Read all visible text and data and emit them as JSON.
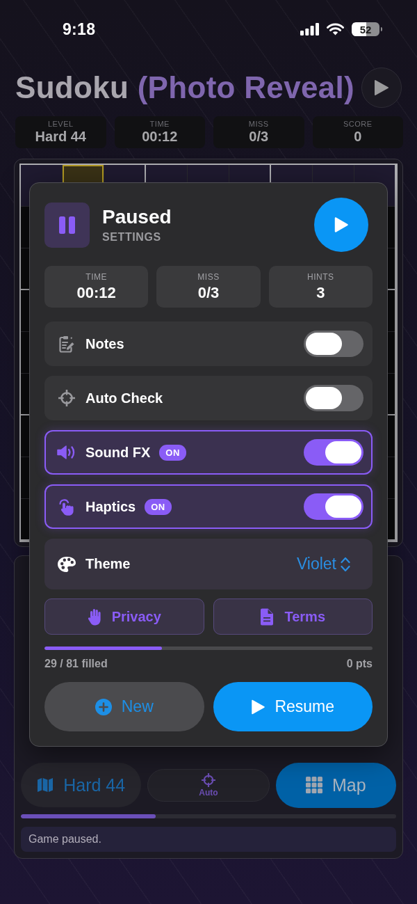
{
  "status_bar": {
    "time": "9:18",
    "battery": "52"
  },
  "header": {
    "title": "Sudoku",
    "title_accent": "(Photo Reveal)"
  },
  "stats": [
    {
      "label": "LEVEL",
      "value": "Hard 44"
    },
    {
      "label": "TIME",
      "value": "00:12"
    },
    {
      "label": "MISS",
      "value": "0/3"
    },
    {
      "label": "SCORE",
      "value": "0"
    }
  ],
  "board": {
    "top_row": [
      {
        "selected": false
      },
      {
        "selected": true
      },
      {
        "selected": false
      },
      {
        "selected": false
      },
      {
        "selected": false
      },
      {
        "selected": false
      },
      {
        "selected": false
      },
      {
        "selected": false
      },
      {
        "selected": false
      }
    ]
  },
  "bottom_bar": {
    "buttons": [
      {
        "kind": "level",
        "label": "Hard 44"
      },
      {
        "kind": "compact",
        "label": "Auto"
      },
      {
        "kind": "primary",
        "label": "Map"
      }
    ],
    "progress": {
      "level": 0.36
    },
    "status": "Game paused."
  },
  "pause_dialog": {
    "title": "Paused",
    "subtitle": "SETTINGS",
    "stats": [
      {
        "label": "TIME",
        "value": "00:12"
      },
      {
        "label": "MISS",
        "value": "0/3"
      },
      {
        "label": "HINTS",
        "value": "3"
      }
    ],
    "settings": [
      {
        "kind": "toggle",
        "label": "Notes",
        "on": false
      },
      {
        "kind": "toggle",
        "label": "Auto Check",
        "on": false
      },
      {
        "kind": "toggle",
        "label": "Sound FX",
        "on": true,
        "badge": "ON"
      },
      {
        "kind": "toggle",
        "label": "Haptics",
        "on": true,
        "badge": "ON"
      },
      {
        "kind": "picker",
        "label": "Theme",
        "value": "Violet"
      }
    ],
    "links": [
      {
        "label": "Privacy"
      },
      {
        "label": "Terms"
      }
    ],
    "progress": {
      "level": 0.358,
      "filled": "29 / 81 filled",
      "points": "0 pts"
    },
    "actions": [
      {
        "kind": "secondary",
        "label": "New"
      },
      {
        "kind": "primary",
        "label": "Resume"
      }
    ]
  }
}
